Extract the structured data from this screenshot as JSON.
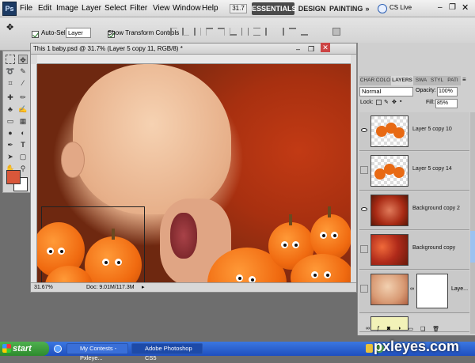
{
  "app": {
    "logo": "Ps"
  },
  "menu": [
    "File",
    "Edit",
    "Image",
    "Layer",
    "Select",
    "Filter",
    "View",
    "Window",
    "Help"
  ],
  "app_bar": {
    "zoom": "31.7"
  },
  "workspace": {
    "essentials": "ESSENTIALS",
    "design": "DESIGN",
    "painting": "PAINTING",
    "more": "»",
    "cs_live": "CS Live"
  },
  "options_bar": {
    "auto_select_label": "Auto-Select:",
    "auto_select_value": "Layer",
    "transform_controls_label": "Show Transform Controls"
  },
  "document": {
    "title": "This 1 baby.psd @ 31.7% (Layer 5 copy 11, RGB/8) *",
    "zoom": "31.67%",
    "doc_size": "Doc: 9.01M/117.3M"
  },
  "layers_panel": {
    "tabs": [
      "CHAR",
      "COLO",
      "LAYERS",
      "SWA",
      "STYL",
      "PATI"
    ],
    "blend_mode": "Normal",
    "opacity_label": "Opacity:",
    "opacity_value": "100%",
    "lock_label": "Lock:",
    "fill_label": "Fill:",
    "fill_value": "85%",
    "layers": [
      {
        "name": "Layer 5 copy 10",
        "visible": true
      },
      {
        "name": "Layer 5 copy 14",
        "visible": false
      },
      {
        "name": "Background copy 2",
        "visible": true
      },
      {
        "name": "Background copy",
        "visible": false
      },
      {
        "name": "Laye...",
        "visible": false
      }
    ]
  },
  "taskbar": {
    "start": "start",
    "items": [
      "My Contests - Pxleye...",
      "Adobe Photoshop CS5"
    ]
  },
  "watermark": "pxleyes.com",
  "colors": {
    "foreground": "#d9573a",
    "background": "#ffffff"
  }
}
